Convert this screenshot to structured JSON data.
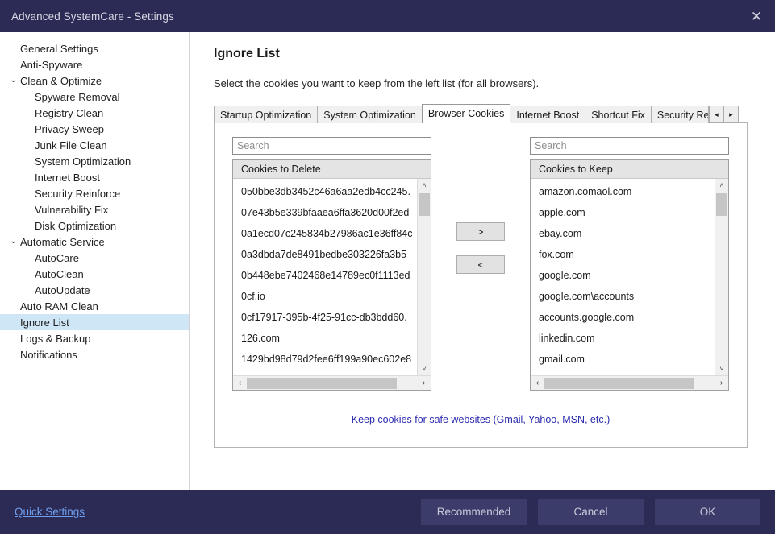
{
  "window": {
    "title": "Advanced SystemCare - Settings",
    "close_icon": "close-icon",
    "accent_color": "#2b2b55",
    "selection_color": "#cfe6f7",
    "link_color": "#2a2ab0",
    "quick_link_color": "#6f9ff0"
  },
  "sidebar": {
    "items": [
      {
        "label": "General Settings",
        "level": 0,
        "caret": "",
        "selected": false
      },
      {
        "label": "Anti-Spyware",
        "level": 0,
        "caret": "",
        "selected": false
      },
      {
        "label": "Clean & Optimize",
        "level": 0,
        "caret": "⌄",
        "selected": false
      },
      {
        "label": "Spyware Removal",
        "level": 1,
        "caret": "",
        "selected": false
      },
      {
        "label": "Registry Clean",
        "level": 1,
        "caret": "",
        "selected": false
      },
      {
        "label": "Privacy Sweep",
        "level": 1,
        "caret": "",
        "selected": false
      },
      {
        "label": "Junk File Clean",
        "level": 1,
        "caret": "",
        "selected": false
      },
      {
        "label": "System Optimization",
        "level": 1,
        "caret": "",
        "selected": false
      },
      {
        "label": "Internet Boost",
        "level": 1,
        "caret": "",
        "selected": false
      },
      {
        "label": "Security Reinforce",
        "level": 1,
        "caret": "",
        "selected": false
      },
      {
        "label": "Vulnerability Fix",
        "level": 1,
        "caret": "",
        "selected": false
      },
      {
        "label": "Disk Optimization",
        "level": 1,
        "caret": "",
        "selected": false
      },
      {
        "label": "Automatic Service",
        "level": 0,
        "caret": "⌄",
        "selected": false
      },
      {
        "label": "AutoCare",
        "level": 1,
        "caret": "",
        "selected": false
      },
      {
        "label": "AutoClean",
        "level": 1,
        "caret": "",
        "selected": false
      },
      {
        "label": "AutoUpdate",
        "level": 1,
        "caret": "",
        "selected": false
      },
      {
        "label": "Auto RAM Clean",
        "level": 0,
        "caret": "",
        "selected": false
      },
      {
        "label": "Ignore List",
        "level": 0,
        "caret": "",
        "selected": true
      },
      {
        "label": "Logs & Backup",
        "level": 0,
        "caret": "",
        "selected": false
      },
      {
        "label": "Notifications",
        "level": 0,
        "caret": "",
        "selected": false
      }
    ]
  },
  "main": {
    "title": "Ignore List",
    "subtitle": "Select the cookies you want to keep from the left list (for all browsers).",
    "tabs": [
      {
        "label": "Startup Optimization",
        "active": false,
        "clipped": false
      },
      {
        "label": "System Optimization",
        "active": false,
        "clipped": false
      },
      {
        "label": "Browser Cookies",
        "active": true,
        "clipped": false
      },
      {
        "label": "Internet Boost",
        "active": false,
        "clipped": false
      },
      {
        "label": "Shortcut Fix",
        "active": false,
        "clipped": false
      },
      {
        "label": "Security Reinforce",
        "active": false,
        "clipped": true
      }
    ],
    "tab_scroll": {
      "prev_icon": "chevron-left-icon",
      "prev_label": "◂",
      "next_icon": "chevron-right-icon",
      "next_label": "▸"
    },
    "left_list": {
      "search_placeholder": "Search",
      "search_value": "",
      "header": "Cookies to Delete",
      "items": [
        "050bbe3db3452c46a6aa2edb4cc245.",
        "07e43b5e339bfaaea6ffa3620d00f2ed",
        "0a1ecd07c245834b27986ac1e36ff84c",
        "0a3dbda7de8491bedbe303226fa3b5",
        "0b448ebe7402468e14789ec0f1113ed",
        "0cf.io",
        "0cf17917-395b-4f25-91cc-db3bdd60.",
        "126.com",
        "1429bd98d79d2fee6ff199a90ec602e8"
      ]
    },
    "right_list": {
      "search_placeholder": "Search",
      "search_value": "",
      "header": "Cookies to Keep",
      "items": [
        "amazon.comaol.com",
        "apple.com",
        "ebay.com",
        "fox.com",
        "google.com",
        "google.com\\accounts",
        "accounts.google.com",
        "linkedin.com",
        "gmail.com"
      ]
    },
    "transfer": {
      "move_right_label": ">",
      "move_left_label": "<"
    },
    "safe_link": "Keep cookies for safe websites (Gmail, Yahoo, MSN, etc.)",
    "scroll_icons": {
      "up": "˄",
      "down": "˅",
      "left": "‹",
      "right": "›"
    }
  },
  "footer": {
    "quick_settings": "Quick Settings",
    "recommended": "Recommended",
    "cancel": "Cancel",
    "ok": "OK"
  }
}
